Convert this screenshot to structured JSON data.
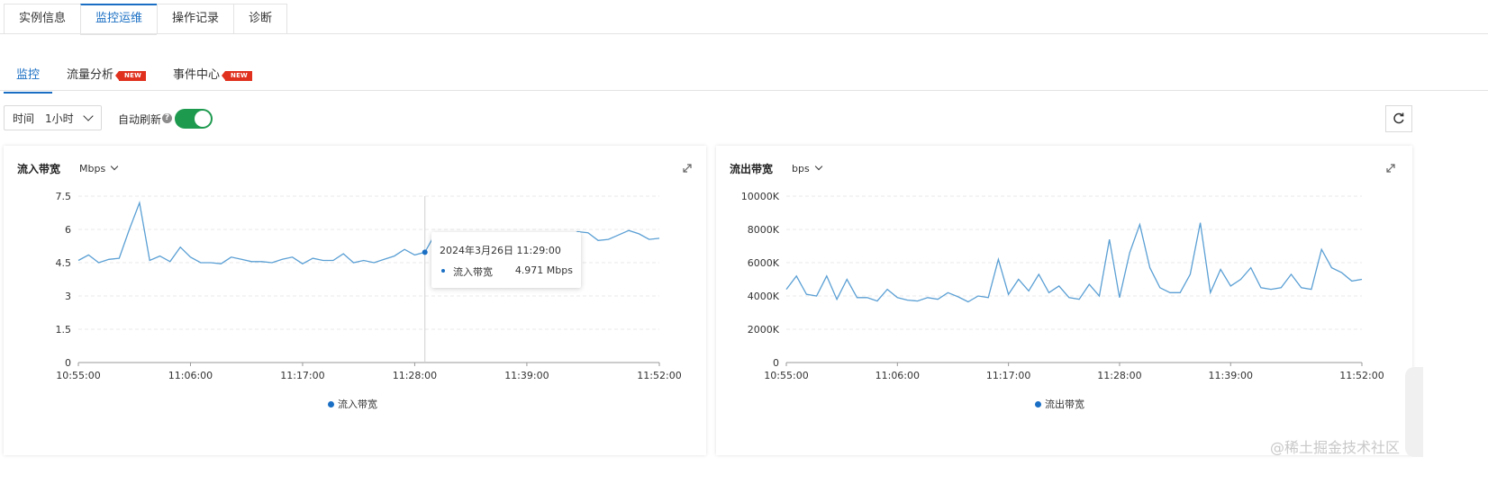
{
  "top_tabs": [
    "实例信息",
    "监控运维",
    "操作记录",
    "诊断"
  ],
  "sub_tabs": [
    {
      "label": "监控",
      "badge": ""
    },
    {
      "label": "流量分析",
      "badge": "NEW"
    },
    {
      "label": "事件中心",
      "badge": "NEW"
    }
  ],
  "toolbar": {
    "time_label": "时间",
    "time_value": "1小时",
    "auto_refresh_label": "自动刷新",
    "help_glyph": "?",
    "auto_refresh_on": true
  },
  "charts": {
    "inbound": {
      "title": "流入带宽",
      "unit": "Mbps",
      "legend": "流入带宽",
      "tooltip": {
        "time": "2024年3月26日 11:29:00",
        "name": "流入带宽",
        "value": "4.971 Mbps"
      }
    },
    "outbound": {
      "title": "流出带宽",
      "unit": "bps",
      "legend": "流出带宽"
    }
  },
  "chart_data": [
    {
      "type": "line",
      "title": "流入带宽",
      "ylabel": "Mbps",
      "x_ticks": [
        "10:55:00",
        "11:06:00",
        "11:17:00",
        "11:28:00",
        "11:39:00",
        "11:52:00"
      ],
      "y_ticks": [
        "0",
        "1.5",
        "3",
        "4.5",
        "6",
        "7.5"
      ],
      "ylim": [
        0,
        7.5
      ],
      "xlim": [
        "10:55:00",
        "11:52:00"
      ],
      "series": [
        {
          "name": "流入带宽",
          "color": "#5a9fd4",
          "x": [
            "10:55",
            "10:56",
            "10:57",
            "10:58",
            "10:59",
            "11:00",
            "11:01",
            "11:02",
            "11:03",
            "11:04",
            "11:05",
            "11:06",
            "11:07",
            "11:08",
            "11:09",
            "11:10",
            "11:11",
            "11:12",
            "11:13",
            "11:14",
            "11:15",
            "11:16",
            "11:17",
            "11:18",
            "11:19",
            "11:20",
            "11:21",
            "11:22",
            "11:23",
            "11:24",
            "11:25",
            "11:26",
            "11:27",
            "11:28",
            "11:29",
            "11:30",
            "11:31",
            "11:32",
            "11:33",
            "11:34",
            "11:35",
            "11:36",
            "11:37",
            "11:38",
            "11:39",
            "11:40",
            "11:41",
            "11:42",
            "11:43",
            "11:44",
            "11:45",
            "11:46",
            "11:47",
            "11:48",
            "11:49",
            "11:50",
            "11:51",
            "11:52"
          ],
          "values": [
            4.6,
            4.85,
            4.5,
            4.65,
            4.7,
            6.0,
            7.2,
            4.6,
            4.8,
            4.55,
            5.2,
            4.75,
            4.5,
            4.5,
            4.45,
            4.75,
            4.65,
            4.55,
            4.55,
            4.5,
            4.65,
            4.75,
            4.45,
            4.7,
            4.6,
            4.6,
            4.9,
            4.5,
            4.6,
            4.5,
            4.65,
            4.8,
            5.1,
            4.85,
            4.971,
            5.8,
            5.6,
            5.7,
            5.5,
            5.6,
            5.45,
            5.5,
            5.6,
            5.7,
            5.5,
            5.6,
            5.55,
            5.6,
            5.65,
            5.9,
            5.85,
            5.5,
            5.55,
            5.75,
            5.95,
            5.8,
            5.55,
            5.6
          ]
        }
      ],
      "grid": true,
      "legend": "bottom-center"
    },
    {
      "type": "line",
      "title": "流出带宽",
      "ylabel": "bps",
      "x_ticks": [
        "10:55:00",
        "11:06:00",
        "11:17:00",
        "11:28:00",
        "11:39:00",
        "11:52:00"
      ],
      "y_ticks": [
        "0",
        "2000K",
        "4000K",
        "6000K",
        "8000K",
        "10000K"
      ],
      "ylim": [
        0,
        10000
      ],
      "xlim": [
        "10:55:00",
        "11:52:00"
      ],
      "series": [
        {
          "name": "流出带宽",
          "color": "#5a9fd4",
          "x": [
            "10:55",
            "10:56",
            "10:57",
            "10:58",
            "10:59",
            "11:00",
            "11:01",
            "11:02",
            "11:03",
            "11:04",
            "11:05",
            "11:06",
            "11:07",
            "11:08",
            "11:09",
            "11:10",
            "11:11",
            "11:12",
            "11:13",
            "11:14",
            "11:15",
            "11:16",
            "11:17",
            "11:18",
            "11:19",
            "11:20",
            "11:21",
            "11:22",
            "11:23",
            "11:24",
            "11:25",
            "11:26",
            "11:27",
            "11:28",
            "11:29",
            "11:30",
            "11:31",
            "11:32",
            "11:33",
            "11:34",
            "11:35",
            "11:36",
            "11:37",
            "11:38",
            "11:39",
            "11:40",
            "11:41",
            "11:42",
            "11:43",
            "11:44",
            "11:45",
            "11:46",
            "11:47",
            "11:48",
            "11:49",
            "11:50",
            "11:51",
            "11:52"
          ],
          "values": [
            4400,
            5200,
            4100,
            4000,
            5200,
            3800,
            5000,
            3900,
            3900,
            3700,
            4400,
            3900,
            3750,
            3700,
            3900,
            3800,
            4200,
            3950,
            3650,
            4000,
            3900,
            6200,
            4100,
            5000,
            4300,
            5300,
            4200,
            4600,
            3900,
            3800,
            4700,
            4000,
            7400,
            3900,
            6600,
            8300,
            5700,
            4500,
            4200,
            4200,
            5300,
            8400,
            4200,
            5600,
            4600,
            5000,
            5700,
            4500,
            4400,
            4500,
            5300,
            4500,
            4400,
            6800,
            5700,
            5400,
            4900,
            5000
          ]
        }
      ],
      "grid": true,
      "legend": "bottom-center"
    }
  ],
  "colors": {
    "accent": "#1a6fc4",
    "line": "#5a9fd4",
    "toggle_on": "#1e9a4f",
    "badge": "#e0301e"
  },
  "watermark": "@稀土掘金技术社区"
}
